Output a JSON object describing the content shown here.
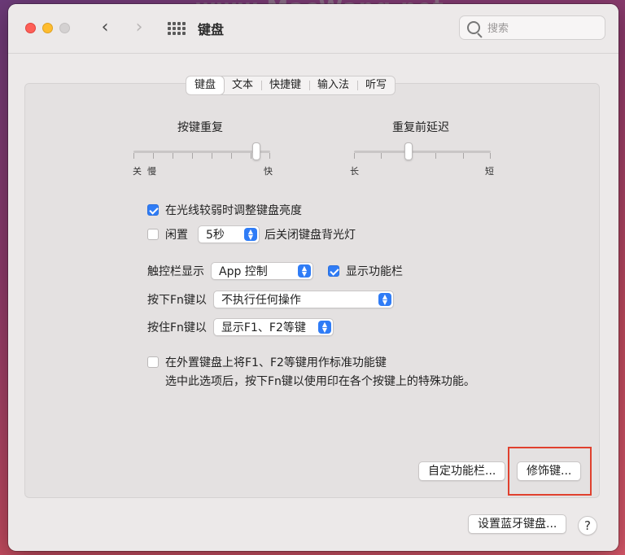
{
  "watermark": "www.MacWang.net",
  "window": {
    "title": "键盘",
    "search_placeholder": "搜索"
  },
  "tabs": [
    {
      "label": "键盘",
      "active": true
    },
    {
      "label": "文本",
      "active": false
    },
    {
      "label": "快捷键",
      "active": false
    },
    {
      "label": "输入法",
      "active": false
    },
    {
      "label": "听写",
      "active": false
    }
  ],
  "key_repeat": {
    "title": "按键重复",
    "label_off": "关",
    "label_slow": "慢",
    "label_fast": "快",
    "level": 0.9
  },
  "delay_until_repeat": {
    "title": "重复前延迟",
    "label_long": "长",
    "label_short": "短",
    "level": 0.4
  },
  "options": {
    "adjust_brightness": {
      "label": "在光线较弱时调整键盘亮度",
      "checked": true
    },
    "turn_off_backlight": {
      "prefix": "闲置",
      "value": "5秒",
      "suffix": "后关闭键盘背光灯",
      "checked": false
    },
    "touch_bar_shows": {
      "label": "触控栏显示",
      "value": "App 控制"
    },
    "show_function_bar": {
      "label": "显示功能栏",
      "checked": true
    },
    "press_fn": {
      "label": "按下Fn键以",
      "value": "不执行任何操作"
    },
    "hold_fn": {
      "label": "按住Fn键以",
      "value": "显示F1、F2等键"
    },
    "use_f_keys": {
      "label": "在外置键盘上将F1、F2等键用作标准功能键",
      "description": "选中此选项后，按下Fn键以使用印在各个按键上的特殊功能。",
      "checked": false
    }
  },
  "buttons": {
    "customize_control_strip": "自定功能栏...",
    "modifier_keys": "修饰键...",
    "setup_bluetooth_keyboard": "设置蓝牙键盘...",
    "help": "?"
  },
  "colors": {
    "accent": "#2f7cf6",
    "highlight_box": "#e0402e"
  }
}
